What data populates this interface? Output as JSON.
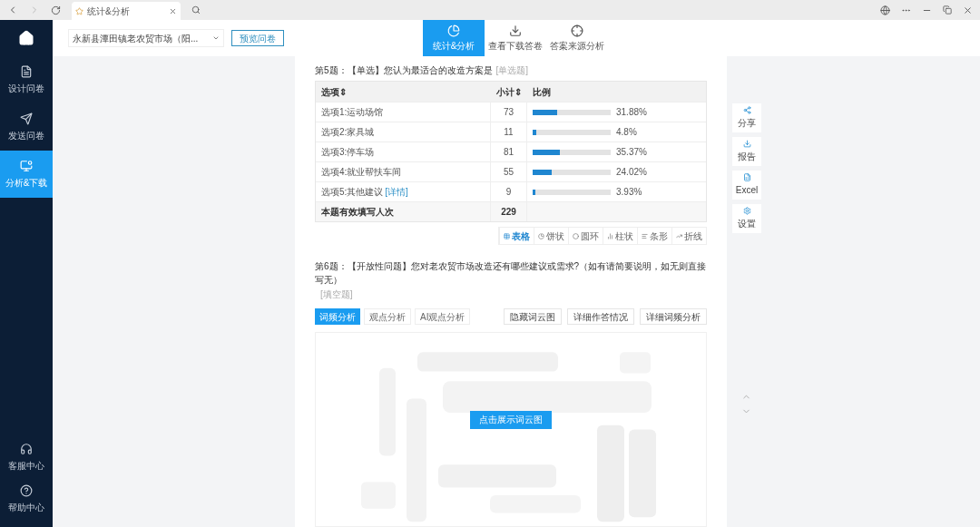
{
  "browser": {
    "tab_title": "统计&分析"
  },
  "sidebar": {
    "items": [
      {
        "label": "设计问卷",
        "kind": "design",
        "selected": false
      },
      {
        "label": "发送问卷",
        "kind": "send",
        "selected": false
      },
      {
        "label": "分析&下载",
        "kind": "chart",
        "selected": true
      }
    ],
    "bottom_items": [
      {
        "label": "客服中心",
        "kind": "headset"
      },
      {
        "label": "帮助中心",
        "kind": "help"
      }
    ]
  },
  "header": {
    "survey_select": "永新县潭田镇老农贸市场（阳...",
    "preview_button": "预览问卷",
    "nav": [
      {
        "label": "统计&分析",
        "kind": "pie",
        "selected": true
      },
      {
        "label": "查看下载答卷",
        "kind": "download",
        "selected": false
      },
      {
        "label": "答案来源分析",
        "kind": "target",
        "selected": false
      }
    ]
  },
  "q5": {
    "title": "第5题：【单选】您认为最适合的改造方案是",
    "type_tag": "[单选题]",
    "columns": [
      "选项⇕",
      "小计⇕",
      "比例"
    ],
    "rows": [
      {
        "option": "选项1:运动场馆",
        "count": "73",
        "level": 0.3188,
        "percent": "31.88%"
      },
      {
        "option": "选项2:家具城",
        "count": "11",
        "level": 0.048,
        "percent": "4.8%"
      },
      {
        "option": "选项3:停车场",
        "count": "81",
        "level": 0.3537,
        "percent": "35.37%"
      },
      {
        "option": "选项4:就业帮扶车间",
        "count": "55",
        "level": 0.2402,
        "percent": "24.02%"
      },
      {
        "option": "选项5:其他建议",
        "link": "[详情]",
        "count": "9",
        "level": 0.0393,
        "percent": "3.93%"
      }
    ],
    "total": {
      "label": "本题有效填写人次",
      "count": "229"
    },
    "views": [
      {
        "label": "表格",
        "kind": "table",
        "selected": true
      },
      {
        "label": "饼状",
        "kind": "pie",
        "selected": false
      },
      {
        "label": "圆环",
        "kind": "ring",
        "selected": false
      },
      {
        "label": "柱状",
        "kind": "column",
        "selected": false
      },
      {
        "label": "条形",
        "kind": "bar",
        "selected": false
      },
      {
        "label": "折线",
        "kind": "line",
        "selected": false
      }
    ]
  },
  "q6": {
    "title": "第6题：【开放性问题】您对老农贸市场改造还有哪些建议或需求?（如有请简要说明，如无则直接写无）",
    "type_tag": "[填空题]",
    "tabs": [
      {
        "label": "词频分析",
        "selected": true
      },
      {
        "label": "观点分析",
        "selected": false
      },
      {
        "label": "AI观点分析",
        "selected": false
      }
    ],
    "actions": [
      "隐藏词云图",
      "详细作答情况",
      "详细词频分析"
    ],
    "show_button": "点击展示词云图"
  },
  "right_tools": [
    {
      "label": "分享",
      "kind": "share"
    },
    {
      "label": "报告",
      "kind": "download"
    },
    {
      "label": "Excel",
      "kind": "excel"
    },
    {
      "label": "设置",
      "kind": "gear"
    }
  ]
}
